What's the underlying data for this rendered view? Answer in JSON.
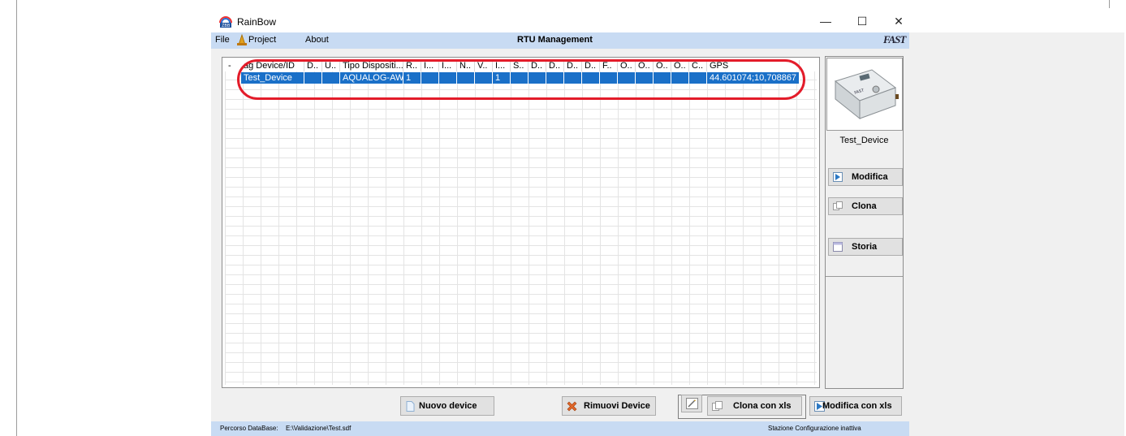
{
  "window": {
    "title": "RainBow",
    "minimize": "—",
    "maximize": "☐",
    "close": "✕"
  },
  "menu": {
    "file": "File",
    "project": "Project",
    "about": "About",
    "center_title": "RTU Management",
    "logo_text": "FAST"
  },
  "grid": {
    "columns": [
      "ag Device/ID",
      "D..",
      "U..",
      "Tipo Dispositi...",
      "R..",
      "I...",
      "I...",
      "N..",
      "V..",
      "I...",
      "S..",
      "D..",
      "D..",
      "D..",
      "D..",
      "F..",
      "O..",
      "O..",
      "O..",
      "O..",
      "C..",
      "GPS"
    ],
    "rows": [
      [
        "Test_Device",
        "",
        "",
        "AQUALOG-AW",
        "1",
        "",
        "",
        "",
        "",
        "1",
        "",
        "",
        "",
        "",
        "",
        "",
        "",
        "",
        "",
        "",
        "",
        "44.601074;10,708867"
      ]
    ],
    "collapse_glyph": "-"
  },
  "side": {
    "device_name": "Test_Device",
    "modifica": "Modifica",
    "clona": "Clona",
    "storia": "Storia"
  },
  "bottom": {
    "nuovo_device": "Nuovo device",
    "rimuovi_device": "Rimuovi Device",
    "clona_xls": "Clona con xls",
    "modifica_xls": "Modifica con xls"
  },
  "status": {
    "db_label": "Percorso DataBase:",
    "db_path": "E:\\Validazione\\Test.sdf",
    "station": "Stazione Configurazione inattiva"
  },
  "colors": {
    "menubar": "#c8dbf3",
    "selection": "#1a70c8",
    "highlight_oval": "#e31c2a"
  }
}
